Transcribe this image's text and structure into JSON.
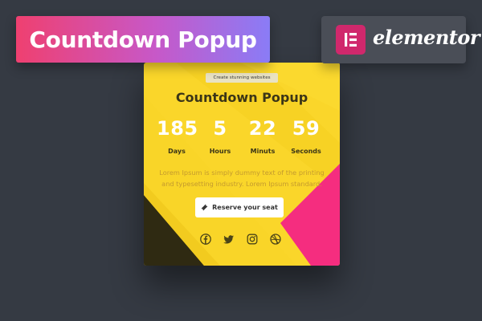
{
  "badge": {
    "title": "Countdown Popup"
  },
  "brand": {
    "name": "elementor",
    "logo_icon": "elementor-logo-icon",
    "logo_color": "#d0286c"
  },
  "popup": {
    "tagline": "Create stunning websites",
    "title": "Countdown Popup",
    "countdown": [
      {
        "value": "185",
        "label": "Days"
      },
      {
        "value": "5",
        "label": "Hours"
      },
      {
        "value": "22",
        "label": "Minuts"
      },
      {
        "value": "59",
        "label": "Seconds"
      }
    ],
    "description": "Lorem Ipsum is simply dummy text of the printing and typesetting industry. Lorem Ipsum standard.",
    "button": {
      "label": "Reserve your seat",
      "icon": "ticket-icon"
    },
    "socials": [
      "facebook-icon",
      "twitter-icon",
      "instagram-icon",
      "dribbble-icon"
    ]
  },
  "colors": {
    "page_bg": "#353a43",
    "popup_yellow": "#fad62a",
    "accent_pink": "#f52d7f",
    "dark_olive": "#2f2a12",
    "badge_gradient": [
      "#ef4070",
      "#8a7cf6"
    ]
  }
}
